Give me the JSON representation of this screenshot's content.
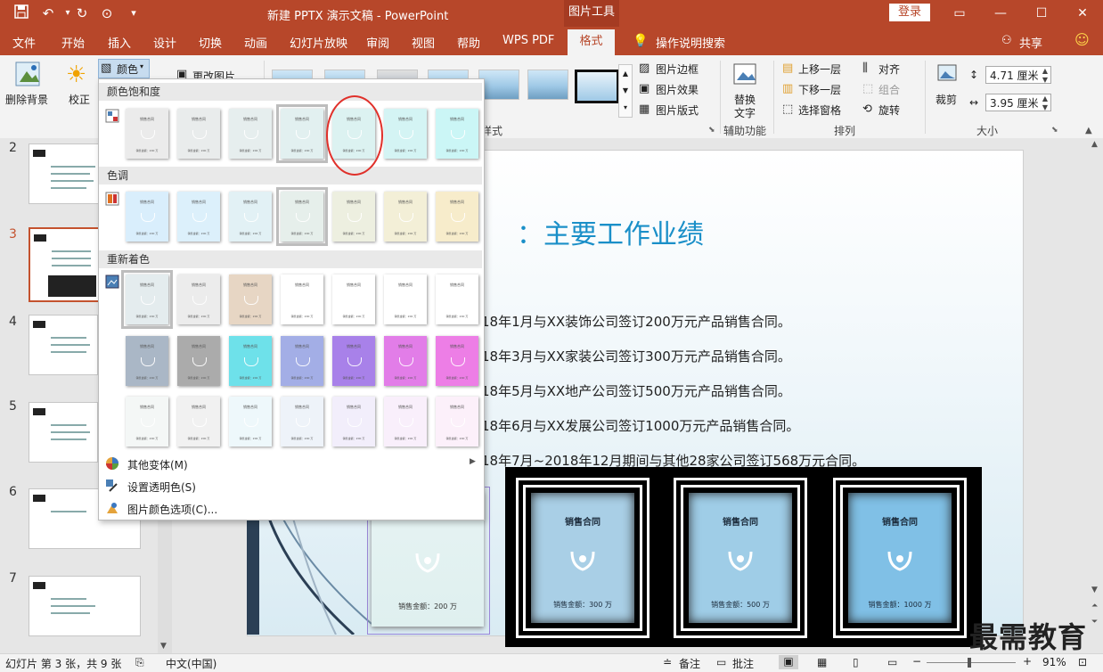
{
  "title_bar": {
    "document_title": "新建 PPTX 演示文稿 - PowerPoint",
    "context_tab": "图片工具",
    "login": "登录",
    "colors": {
      "accent": "#b7472a"
    }
  },
  "menu": {
    "tabs": [
      "文件",
      "开始",
      "插入",
      "设计",
      "切换",
      "动画",
      "幻灯片放映",
      "审阅",
      "视图",
      "帮助",
      "WPS PDF"
    ],
    "active_tab": "格式",
    "tell_me": "操作说明搜索",
    "share": "共享"
  },
  "ribbon": {
    "remove_bg": "删除背景",
    "correct": "校正",
    "color": "颜色",
    "change_picture": "更改图片",
    "picture_border": "图片边框",
    "picture_effects": "图片效果",
    "picture_layout": "图片版式",
    "styles_group": "样式",
    "alt_text_l1": "替换",
    "alt_text_l2": "文字",
    "accessibility_group": "辅助功能",
    "bring_forward": "上移一层",
    "send_backward": "下移一层",
    "selection_pane": "选择窗格",
    "align": "对齐",
    "group": "组合",
    "rotate": "旋转",
    "arrange_group": "排列",
    "crop": "裁剪",
    "height": "4.71 厘米",
    "width": "3.95 厘米",
    "size_group": "大小"
  },
  "color_menu": {
    "saturation_header": "颜色饱和度",
    "tone_header": "色调",
    "recolor_header": "重新着色",
    "swatch_title": "销售合同",
    "swatch_amount": "销售金额：200 万",
    "saturation": [
      "#ebebeb",
      "#e9ecec",
      "#e6eeee",
      "#e2f0f0",
      "#dcf2f1",
      "#d4f4f4",
      "#cbf6f6"
    ],
    "tone": [
      "#d9eefc",
      "#dcf0fb",
      "#e2f1f5",
      "#e6efeb",
      "#edefe0",
      "#f3efd7",
      "#f7eccb"
    ],
    "recolor_row1": [
      "#e4ecee",
      "#ececec",
      "#e7d6c4",
      "#ffffff",
      "#ffffff",
      "#ffffff",
      "#ffffff"
    ],
    "recolor_row2": [
      "#aab7c6",
      "#ababab",
      "#6ee1ea",
      "#a3aee6",
      "#a881e9",
      "#e27de8",
      "#ed7ee6"
    ],
    "recolor_row3": [
      "#f4f7f6",
      "#f1f1f1",
      "#eef8fb",
      "#eef3f9",
      "#f2eefb",
      "#f9effb",
      "#fcf0fa"
    ],
    "more_variations": "其他变体(M)",
    "set_transparent": "设置透明色(S)",
    "color_options": "图片颜色选项(C)..."
  },
  "thumbnails": {
    "numbers": [
      "2",
      "3",
      "4",
      "5",
      "6",
      "7"
    ]
  },
  "slide": {
    "title": "：主要工作业绩",
    "bullets": [
      "18年1月与XX装饰公司签订200万元产品销售合同。",
      "18年3月与XX家装公司签订300万元产品销售合同。",
      "18年5月与XX地产公司签订500万元产品销售合同。",
      "18年6月与XX发展公司签订1000万元产品销售合同。",
      "18年7月~2018年12月期间与其他28家公司签订568万元合同。"
    ],
    "contracts": [
      {
        "title": "销售合同",
        "amount": "销售金额：200 万",
        "color": "#e1f1f1"
      },
      {
        "title": "销售合同",
        "amount": "销售金额：300 万",
        "color": "#a9cfe6"
      },
      {
        "title": "销售合同",
        "amount": "销售金额：500 万",
        "color": "#9fcde7"
      },
      {
        "title": "销售合同",
        "amount": "销售金额：1000 万",
        "color": "#80c0e6"
      }
    ]
  },
  "watermark": "最需教育",
  "status": {
    "slide_info": "幻灯片 第 3 张，共 9 张",
    "language": "中文(中国)",
    "notes": "备注",
    "comments": "批注",
    "zoom": "91%"
  }
}
